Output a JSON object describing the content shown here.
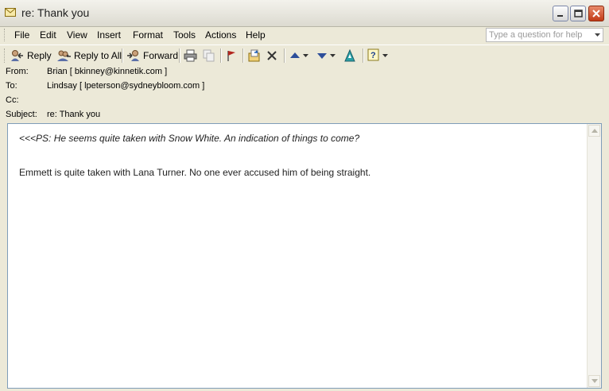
{
  "window": {
    "title": "re: Thank you"
  },
  "menu": {
    "items": [
      "File",
      "Edit",
      "View",
      "Insert",
      "Format",
      "Tools",
      "Actions",
      "Help"
    ],
    "help_placeholder": "Type a question for help"
  },
  "toolbar": {
    "reply": "Reply",
    "reply_all": "Reply to All",
    "forward": "Forward"
  },
  "header": {
    "from_label": "From:",
    "from_value": "Brian [ bkinney@kinnetik.com ]",
    "to_label": "To:",
    "to_value": "Lindsay [ lpeterson@sydneybloom.com ]",
    "cc_label": "Cc:",
    "cc_value": "",
    "subject_label": "Subject:",
    "subject_value": "re: Thank you"
  },
  "message": {
    "quoted": "<<<PS: He seems quite taken with Snow White. An indication of things to come?",
    "reply": "Emmett is quite taken with Lana Turner. No one ever accused him of being straight."
  }
}
